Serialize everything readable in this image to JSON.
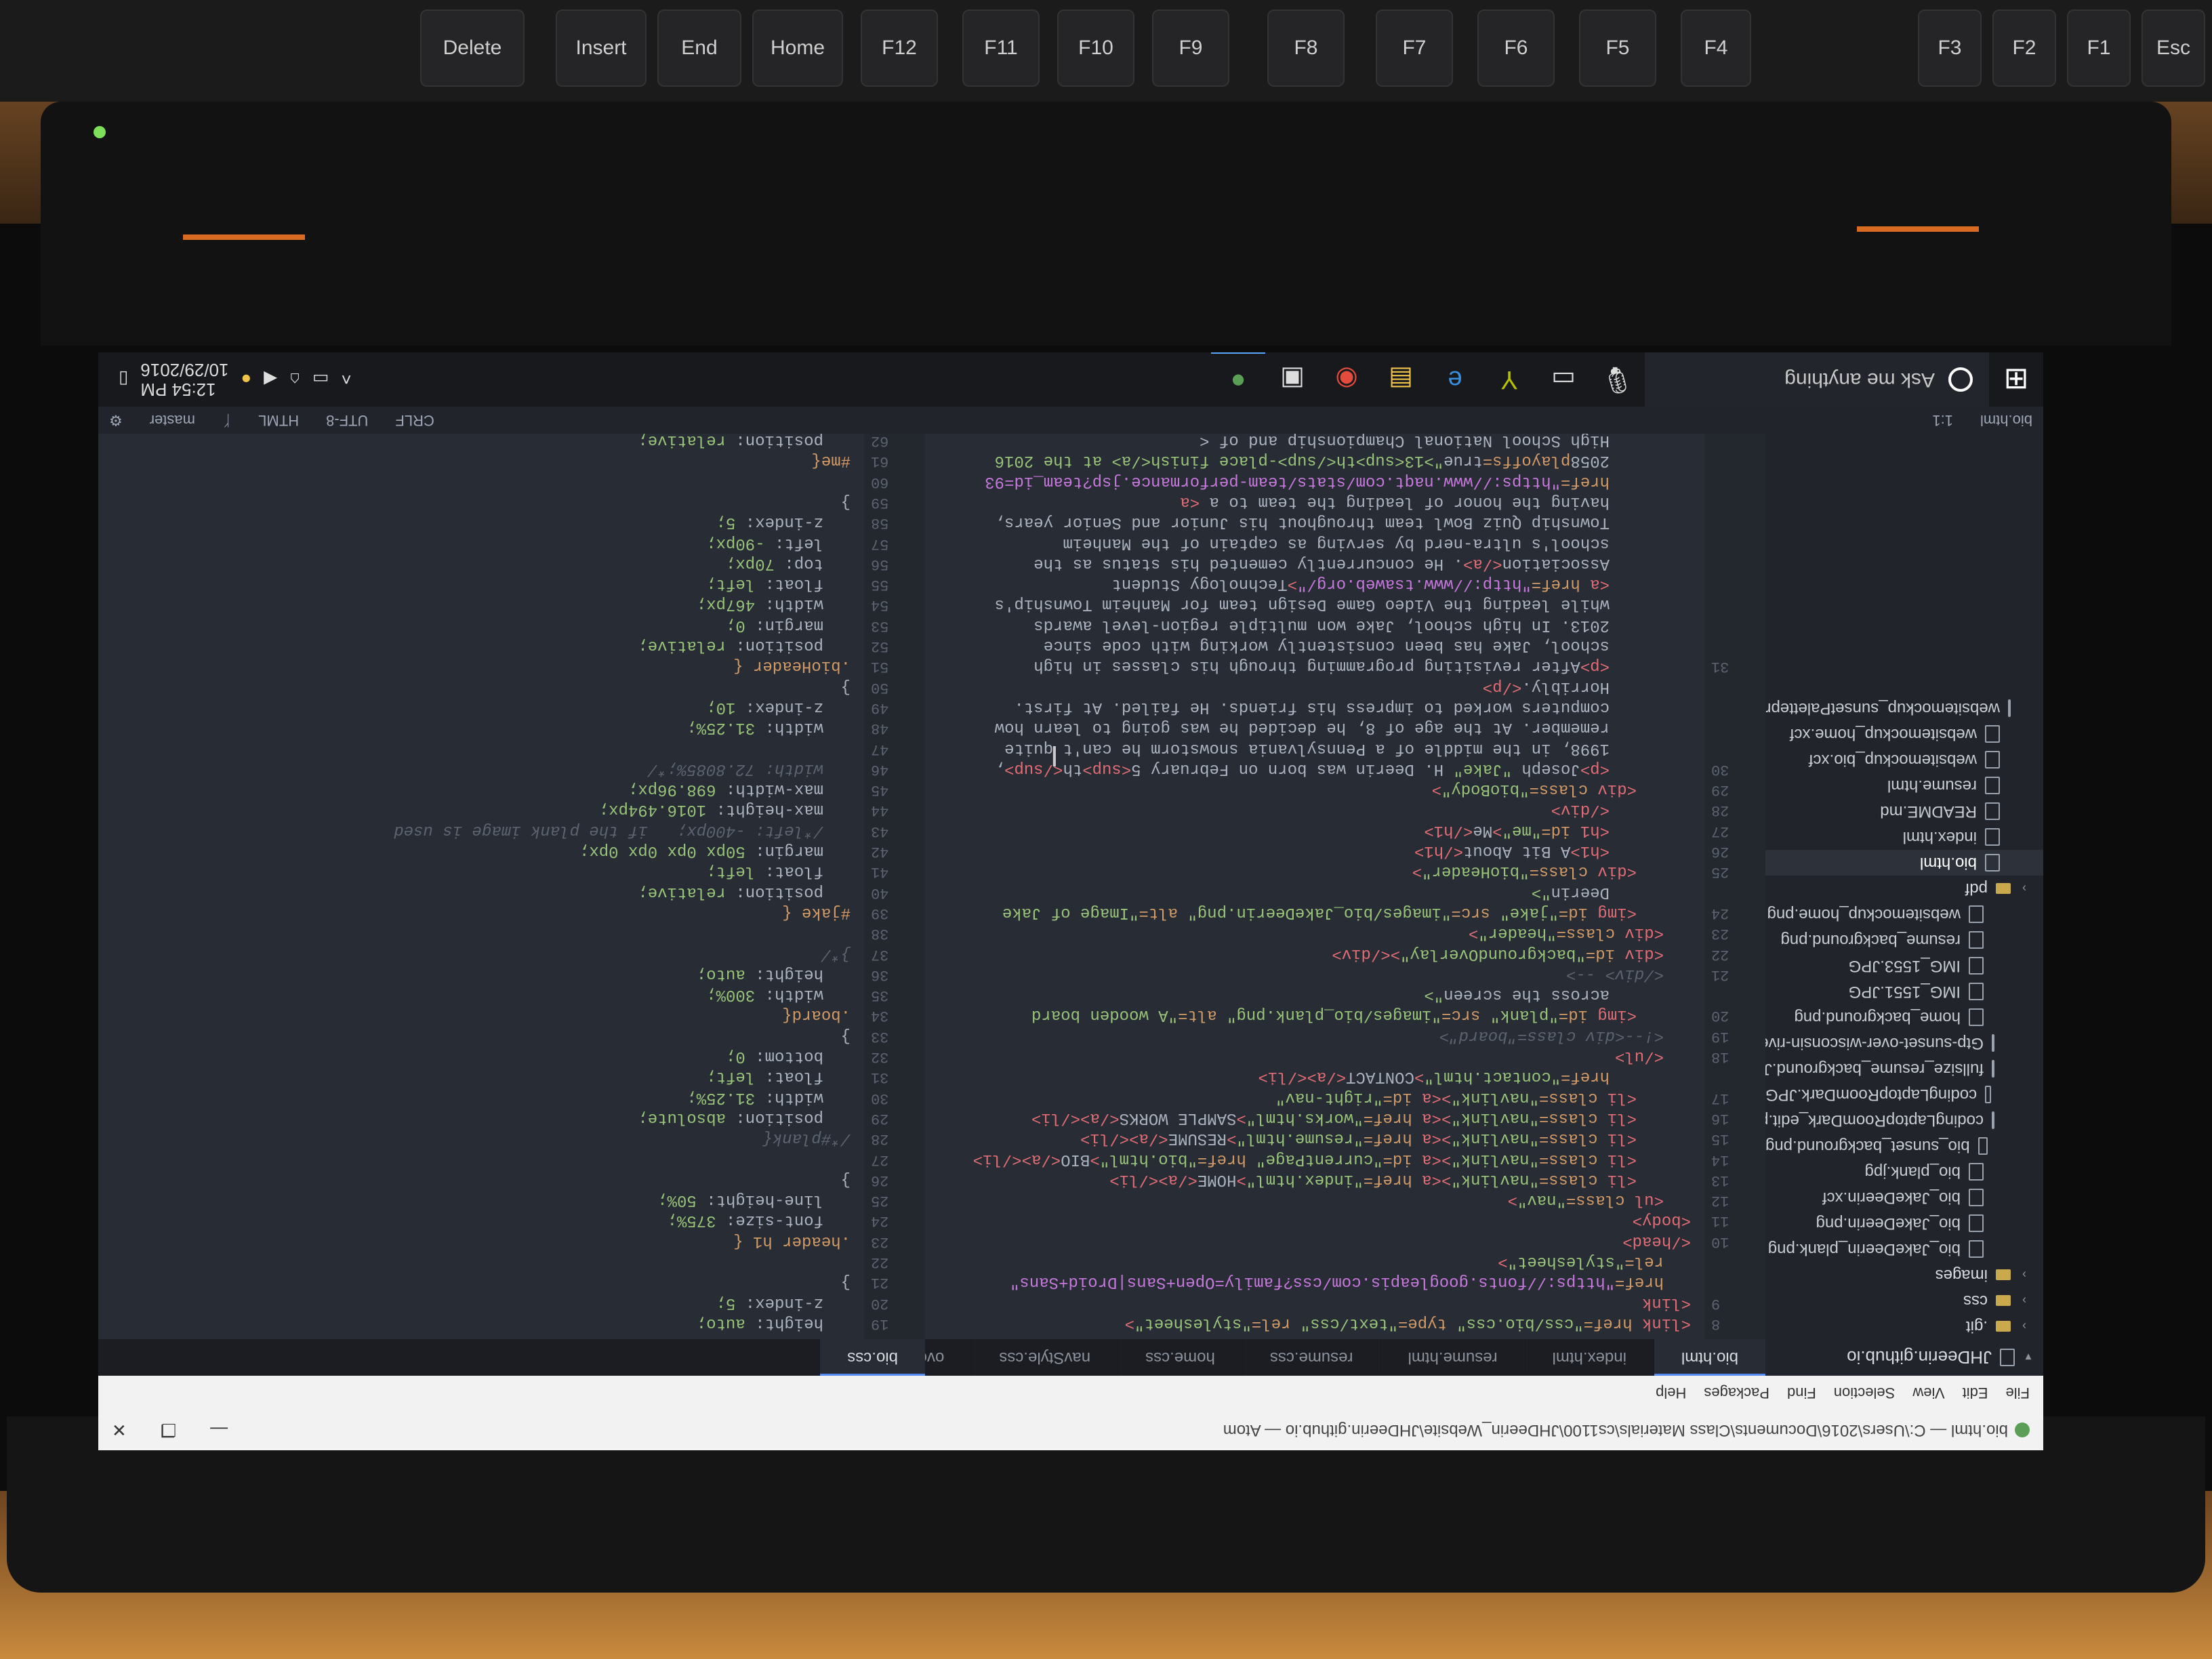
{
  "keyboard": {
    "keys": [
      "Esc",
      "F1",
      "F2",
      "F3",
      "F4",
      "F5",
      "F6",
      "F7",
      "F8",
      "F9",
      "F10",
      "F11",
      "F12",
      "Home",
      "End",
      "Insert",
      "Delete"
    ]
  },
  "window": {
    "title": "bio.html — C:\\Users\\2016\\Documents\\Class Materials\\cs1100\\JHDeerin_Website\\JHDeerin.github.io — Atom",
    "menu": [
      "File",
      "Edit",
      "View",
      "Selection",
      "Find",
      "Packages",
      "Help"
    ]
  },
  "treeview": {
    "root": "JHDeerin.github.io",
    "items": [
      {
        "name": ".git",
        "type": "dir"
      },
      {
        "name": "css",
        "type": "dir"
      },
      {
        "name": "images",
        "type": "dir"
      },
      {
        "name": "bio_JakeDeerin_plank.png",
        "type": "file"
      },
      {
        "name": "bio_JakeDeerin.png",
        "type": "file"
      },
      {
        "name": "bio_JakeDeerin.xcf",
        "type": "file"
      },
      {
        "name": "bio_plank.jpg",
        "type": "file"
      },
      {
        "name": "bio_sunset_background.png",
        "type": "file"
      },
      {
        "name": "codingLaptopRoomDark_edit.png",
        "type": "file"
      },
      {
        "name": "codingLaptopRoomDark.JPG",
        "type": "file"
      },
      {
        "name": "fullsize_resume_background.JPG",
        "type": "file"
      },
      {
        "name": "Gtp-sunset-over-wisconsin-river-in",
        "type": "file"
      },
      {
        "name": "home_background.png",
        "type": "file"
      },
      {
        "name": "IMG_1551.JPG",
        "type": "file"
      },
      {
        "name": "IMG_1553.JPG",
        "type": "file"
      },
      {
        "name": "resume_background.png",
        "type": "file"
      },
      {
        "name": "websitemockup_home.png",
        "type": "file"
      },
      {
        "name": "pdf",
        "type": "dir"
      },
      {
        "name": "bio.html",
        "type": "file",
        "selected": true
      },
      {
        "name": "index.html",
        "type": "file"
      },
      {
        "name": "README.md",
        "type": "file"
      },
      {
        "name": "resume.html",
        "type": "file"
      },
      {
        "name": "websitemockup_bio.xcf",
        "type": "file"
      },
      {
        "name": "websitemockup_home.xcf",
        "type": "file"
      },
      {
        "name": "websitemockup_sunsetPaletteprobabl",
        "type": "file"
      }
    ]
  },
  "tabs_left": [
    "bio.html",
    "index.html",
    "resume.html",
    "resume.css",
    "home.css",
    "navStyle.css",
    "overallStyle.css"
  ],
  "tabs_right": [
    "bio.css"
  ],
  "html_editor": {
    "lines": [
      {
        "n": "8",
        "text": "<link href=\"css/bio.css\" type=\"text/css\" rel=\"stylesheet\">"
      },
      {
        "n": "9",
        "text": "<link"
      },
      {
        "n": "",
        "text": "href=\"https://fonts.googleapis.com/css?family=Open+Sans|Droid+Sans\""
      },
      {
        "n": "",
        "text": "rel=\"stylesheet\">"
      },
      {
        "n": "10",
        "text": "</head>"
      },
      {
        "n": "11",
        "text": "<body>"
      },
      {
        "n": "12",
        "text": "<ul class=\"nav\">"
      },
      {
        "n": "13",
        "text": "<li class=\"navlink\"><a href=\"index.html\">HOME</a></li>"
      },
      {
        "n": "14",
        "text": "<li class=\"navlink\"><a id=\"currentPage\" href=\"bio.html\">BIO</a></li>"
      },
      {
        "n": "15",
        "text": "<li class=\"navlink\"><a href=\"resume.html\">RESUME</a></li>"
      },
      {
        "n": "16",
        "text": "<li class=\"navlink\"><a href=\"works.html\">SAMPLE WORKS</a></li>"
      },
      {
        "n": "17",
        "text": "<li class=\"navlink\"><a id=\"right-nav\""
      },
      {
        "n": "",
        "text": "href=\"contact.html\">CONTACT</a></li>"
      },
      {
        "n": "18",
        "text": "</ul>"
      },
      {
        "n": "19",
        "text": "<!--<div class=\"board\">"
      },
      {
        "n": "20",
        "text": "<img id=\"plank\" src=\"images/bio_plank.png\" alt=\"A wooden board"
      },
      {
        "n": "",
        "text": "across the screen\">"
      },
      {
        "n": "21",
        "text": "</div> -->"
      },
      {
        "n": "22",
        "text": "<div id=\"backgroundOverlay\"></div>"
      },
      {
        "n": "23",
        "text": "<div class=\"header\">"
      },
      {
        "n": "24",
        "text": "<img id=\"jake\" src=\"images/bio_JakeDeerin.png\" alt=\"Image of Jake"
      },
      {
        "n": "",
        "text": "Deerin\">"
      },
      {
        "n": "25",
        "text": "<div class=\"bioHeader\">"
      },
      {
        "n": "26",
        "text": "<h1>A Bit About</h1>"
      },
      {
        "n": "27",
        "text": "<h1 id=\"me\">Me</h1>"
      },
      {
        "n": "28",
        "text": "</div>"
      },
      {
        "n": "29",
        "text": "<div class=\"bioBody\">"
      },
      {
        "n": "30",
        "text": "<p>Joseph \"Jake\" H. Deerin was born on February 5<sup>th</sup>,"
      },
      {
        "n": "",
        "text": "1998, in the middle of a Pennsylvania snowstorm he can't quite"
      },
      {
        "n": "",
        "text": "remember. At the age of 8, he decided he was going to learn how"
      },
      {
        "n": "",
        "text": "computers worked to impress his friends. He failed. At first."
      },
      {
        "n": "",
        "text": "Horribly.</p>"
      },
      {
        "n": "31",
        "text": "<p>After revisiting programming through his classes in high"
      },
      {
        "n": "",
        "text": "school, Jake has been consistently working with code since"
      },
      {
        "n": "",
        "text": "2013. In high school, Jake won multiple region-level awards"
      },
      {
        "n": "",
        "text": "while leading the Video Game Design team for Manheim Township's"
      },
      {
        "n": "",
        "text": "<a href=\"http://www.tsaweb.org/\">Technology Student"
      },
      {
        "n": "",
        "text": "Association</a>. He concurrently cemented his status as the"
      },
      {
        "n": "",
        "text": "school's ultra-nerd by serving as captain of the Manheim"
      },
      {
        "n": "",
        "text": "Township Quiz Bowl team throughout his Junior and Senior years,"
      },
      {
        "n": "",
        "text": "having the honor of leading the team to a <a"
      },
      {
        "n": "",
        "text": "href=\"https://www.naqt.com/stats/team-performance.jsp?team_id=93"
      },
      {
        "n": "",
        "text": "2058playoffs=true\">13<sup>th</sup>-place finish</a> at the 2016"
      },
      {
        "n": "",
        "text": "High School National Championship and of <"
      }
    ]
  },
  "css_editor": {
    "lines": [
      {
        "n": "19",
        "text": "height: auto;"
      },
      {
        "n": "20",
        "text": "z-index: 5;"
      },
      {
        "n": "21",
        "text": "}"
      },
      {
        "n": "22",
        "text": ""
      },
      {
        "n": "23",
        "text": ".header h1 {"
      },
      {
        "n": "24",
        "text": "font-size: 375%;"
      },
      {
        "n": "25",
        "text": "line-height: 50%;"
      },
      {
        "n": "26",
        "text": "}"
      },
      {
        "n": "27",
        "text": ""
      },
      {
        "n": "28",
        "text": "/*#plank{"
      },
      {
        "n": "29",
        "text": "position: absolute;"
      },
      {
        "n": "30",
        "text": "width: 31.25%;"
      },
      {
        "n": "31",
        "text": "float: left;"
      },
      {
        "n": "32",
        "text": "bottom: 0;"
      },
      {
        "n": "33",
        "text": "}"
      },
      {
        "n": "34",
        "text": ".board{"
      },
      {
        "n": "35",
        "text": "width: 300%;"
      },
      {
        "n": "36",
        "text": "height: auto;"
      },
      {
        "n": "37",
        "text": "}*/"
      },
      {
        "n": "38",
        "text": ""
      },
      {
        "n": "39",
        "text": "#jake {"
      },
      {
        "n": "40",
        "text": "position: relative;"
      },
      {
        "n": "41",
        "text": "float: left;"
      },
      {
        "n": "42",
        "text": "margin: 50px 0px 0px 0px;"
      },
      {
        "n": "43",
        "text": "/*left: -400px;   if the plank image is used"
      },
      {
        "n": "44",
        "text": "max-height: 1016.494px;"
      },
      {
        "n": "45",
        "text": "max-width: 698.96px;"
      },
      {
        "n": "46",
        "text": "width: 72.8085%;*/"
      },
      {
        "n": "47",
        "text": ""
      },
      {
        "n": "48",
        "text": "width: 31.25%;"
      },
      {
        "n": "49",
        "text": "z-index: 10;"
      },
      {
        "n": "50",
        "text": "}"
      },
      {
        "n": "51",
        "text": ".bioHeader {"
      },
      {
        "n": "52",
        "text": "position: relative;"
      },
      {
        "n": "53",
        "text": "margin: 0;"
      },
      {
        "n": "54",
        "text": "width: 467px;"
      },
      {
        "n": "55",
        "text": "float: left;"
      },
      {
        "n": "56",
        "text": "top: 70px;"
      },
      {
        "n": "57",
        "text": "left: -90px;"
      },
      {
        "n": "58",
        "text": "z-index: 5;"
      },
      {
        "n": "59",
        "text": "}"
      },
      {
        "n": "60",
        "text": ""
      },
      {
        "n": "61",
        "text": "#me{"
      },
      {
        "n": "62",
        "text": "position: relative;"
      }
    ]
  },
  "statusbar": {
    "file": "bio.html",
    "position": "1:1",
    "line_ending": "CRLF",
    "encoding": "UTF-8",
    "grammar": "HTML",
    "branch": "master"
  },
  "taskbar": {
    "search_placeholder": "Ask me anything",
    "time": "12:54 PM",
    "date": "10/29/2016"
  },
  "colors": {
    "accent": "#568af2",
    "editor_bg": "#282c34",
    "tree_bg": "#21252b"
  }
}
